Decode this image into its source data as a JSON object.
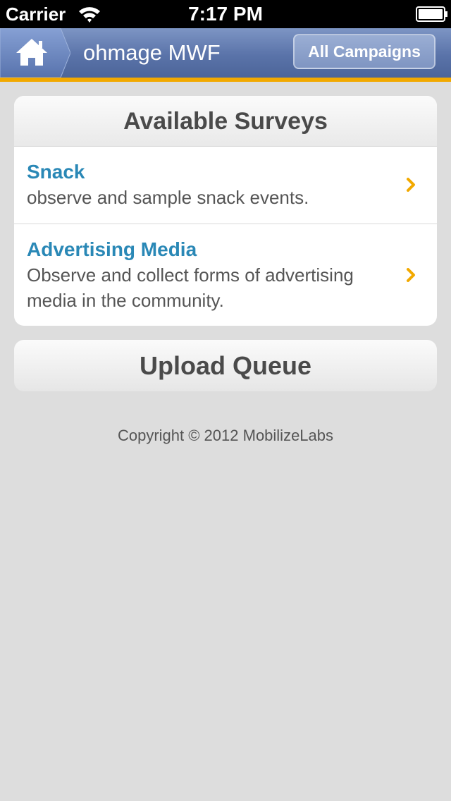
{
  "status_bar": {
    "carrier": "Carrier",
    "time": "7:17 PM",
    "wifi_icon": "wifi-icon",
    "battery_icon": "battery-icon"
  },
  "nav": {
    "home_icon": "home-icon",
    "title": "ohmage MWF",
    "campaigns_button_label": "All Campaigns"
  },
  "surveys": {
    "header": "Available Surveys",
    "items": [
      {
        "title": "Snack",
        "description": "observe and sample snack events.",
        "icon": "chevron-right-icon"
      },
      {
        "title": "Advertising Media",
        "description": "Observe and collect forms of advertising media in the community.",
        "icon": "chevron-right-icon"
      }
    ]
  },
  "upload_queue": {
    "label": "Upload Queue"
  },
  "footer": {
    "copyright": "Copyright © 2012 MobilizeLabs"
  },
  "colors": {
    "nav_gradient_top": "#7d95c4",
    "nav_gradient_bottom": "#4c6599",
    "accent": "#f2a900",
    "survey_title": "#2a88b6",
    "background": "#dddddd"
  }
}
